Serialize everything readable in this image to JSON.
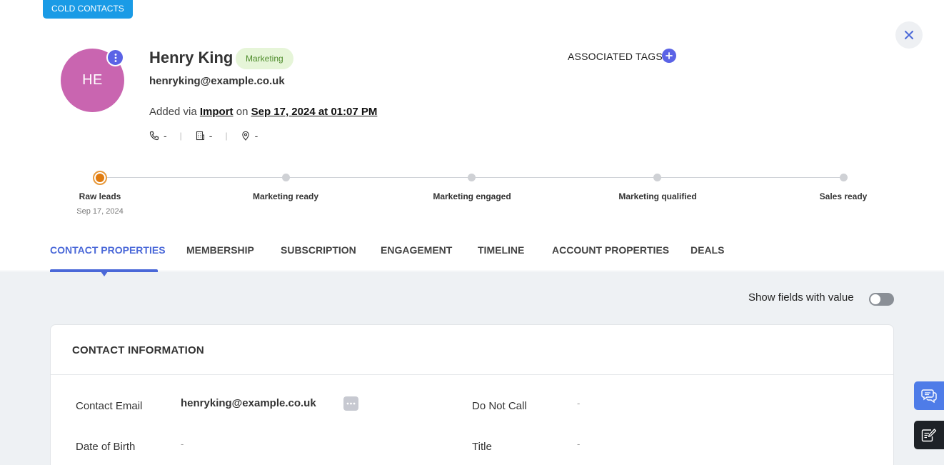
{
  "badge": {
    "label": "COLD CONTACTS",
    "color": "#1a9be6"
  },
  "header": {
    "avatar_initials": "HE",
    "avatar_color": "#c965b0",
    "name": "Henry King",
    "segment": "Marketing",
    "email": "henryking@example.co.uk",
    "added_via_prefix": "Added via",
    "added_via_source": "Import",
    "added_on_word": "on",
    "added_date": "Sep 17, 2024 at 01:07 PM",
    "phone": "-",
    "company": "-",
    "location": "-",
    "icons": [
      "phone-icon",
      "building-icon",
      "location-pin-icon",
      "more-vertical-icon",
      "close-icon"
    ]
  },
  "tags": {
    "label": "ASSOCIATED TAGS",
    "icon": "plus-icon"
  },
  "lifecycle": {
    "stages": [
      {
        "label": "Raw leads",
        "date": "Sep 17, 2024",
        "active": true
      },
      {
        "label": "Marketing ready",
        "date": "",
        "active": false
      },
      {
        "label": "Marketing engaged",
        "date": "",
        "active": false
      },
      {
        "label": "Marketing qualified",
        "date": "",
        "active": false
      },
      {
        "label": "Sales ready",
        "date": "",
        "active": false
      }
    ],
    "active_color": "#e07b0f"
  },
  "tabs": [
    {
      "label": "CONTACT PROPERTIES",
      "active": true
    },
    {
      "label": "MEMBERSHIP",
      "active": false
    },
    {
      "label": "SUBSCRIPTION",
      "active": false
    },
    {
      "label": "ENGAGEMENT",
      "active": false
    },
    {
      "label": "TIMELINE",
      "active": false
    },
    {
      "label": "ACCOUNT PROPERTIES",
      "active": false
    },
    {
      "label": "DEALS",
      "active": false
    }
  ],
  "toolbar": {
    "show_fields_label": "Show fields with value",
    "show_fields_on": false
  },
  "card": {
    "title": "CONTACT INFORMATION",
    "fields": [
      {
        "label": "Contact Email",
        "value": "henryking@example.co.uk"
      },
      {
        "label": "Do Not Call",
        "value": "-"
      },
      {
        "label": "Date of Birth",
        "value": "-"
      },
      {
        "label": "Title",
        "value": "-"
      }
    ]
  },
  "side_buttons": [
    {
      "icon": "chat-icon",
      "color": "#4e7ce8"
    },
    {
      "icon": "notes-icon",
      "color": "#1e2227"
    }
  ],
  "accent_color": "#4a68d8"
}
